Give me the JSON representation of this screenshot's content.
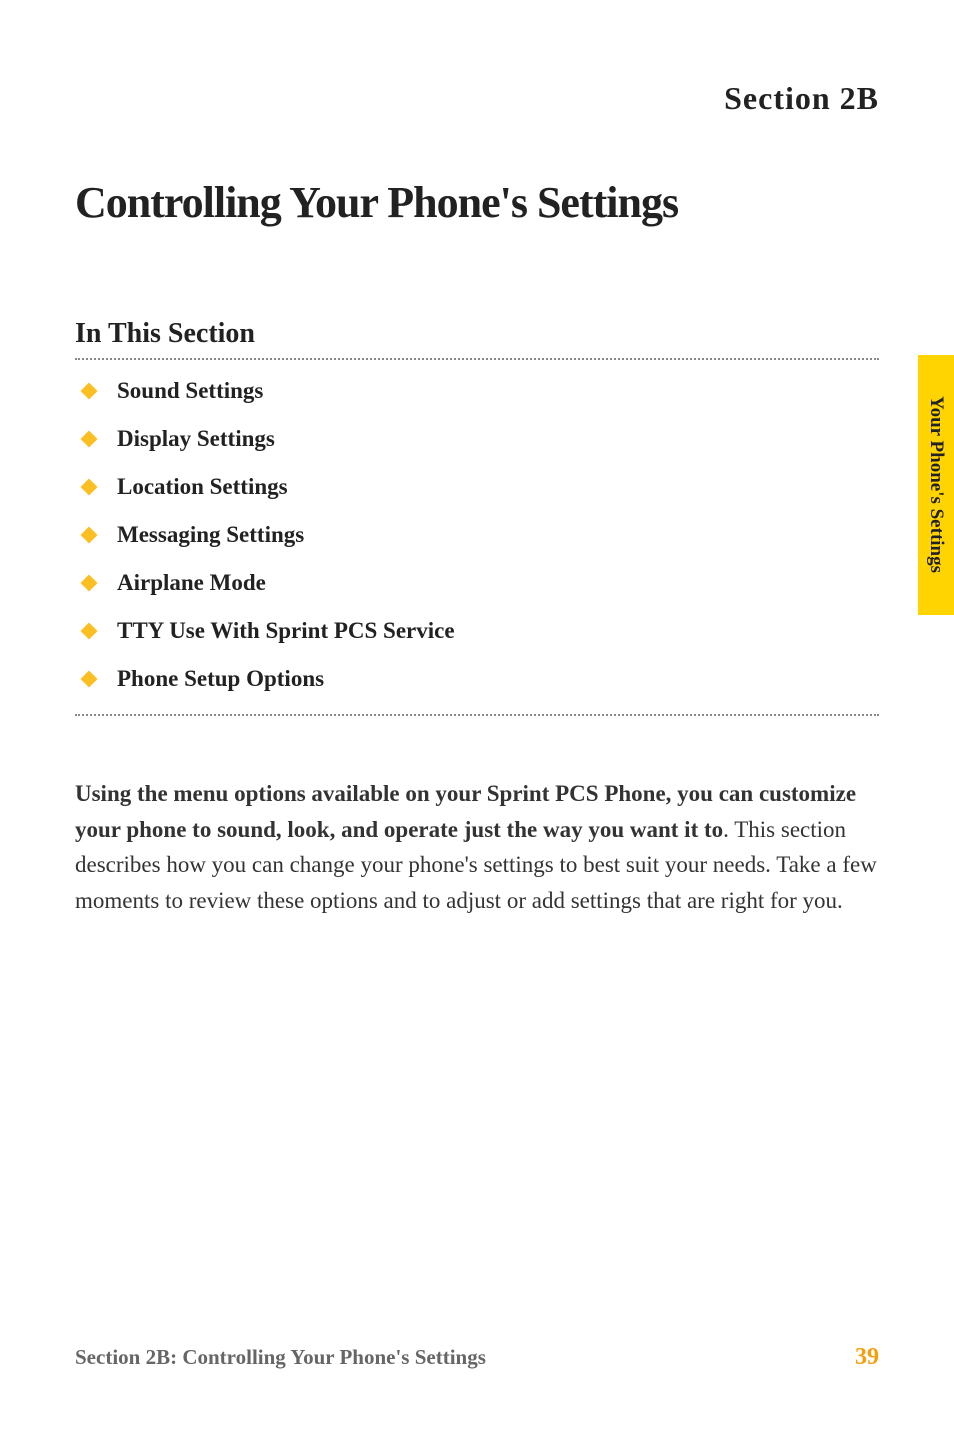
{
  "section_label": "Section 2B",
  "main_title": "Controlling Your Phone's Settings",
  "subsection_title": "In This Section",
  "bullets": [
    "Sound Settings",
    "Display Settings",
    "Location Settings",
    "Messaging Settings",
    "Airplane Mode",
    "TTY Use With Sprint PCS Service",
    "Phone Setup Options"
  ],
  "body_bold": "Using the menu options available on your Sprint PCS Phone, you can customize your phone to sound, look, and operate just the way you want it to",
  "body_rest": ". This section describes how you can change your phone's settings to best suit your needs. Take a few moments to review these options and to adjust or add settings that are right for you.",
  "side_tab": "Your Phone's Settings",
  "footer_left": "Section 2B: Controlling Your Phone's Settings",
  "footer_right": "39"
}
